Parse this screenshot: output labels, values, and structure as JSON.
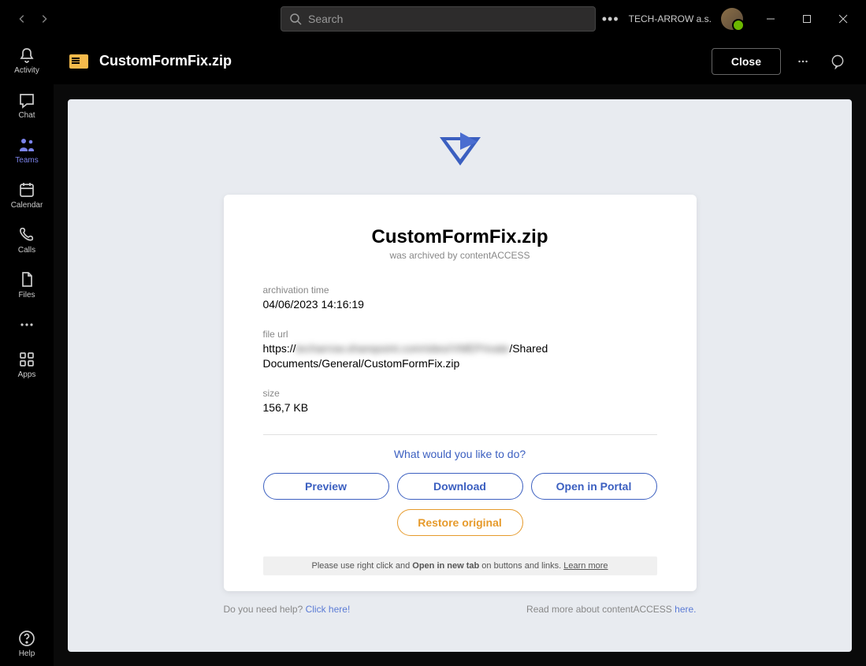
{
  "titlebar": {
    "search_placeholder": "Search",
    "org_name": "TECH-ARROW a.s."
  },
  "rail": {
    "items": [
      {
        "label": "Activity"
      },
      {
        "label": "Chat"
      },
      {
        "label": "Teams"
      },
      {
        "label": "Calendar"
      },
      {
        "label": "Calls"
      },
      {
        "label": "Files"
      }
    ],
    "apps_label": "Apps",
    "help_label": "Help"
  },
  "doc": {
    "title": "CustomFormFix.zip",
    "close_label": "Close"
  },
  "card": {
    "title": "CustomFormFix.zip",
    "subtitle": "was archived by contentACCESS",
    "meta": {
      "archivation_label": "archivation time",
      "archivation_value": "04/06/2023 14:16:19",
      "fileurl_label": "file url",
      "fileurl_prefix": "https://",
      "fileurl_blur": "techarrow.sharepoint.com/sites/VMEPrivate",
      "fileurl_suffix": "/Shared Documents/General/CustomFormFix.zip",
      "size_label": "size",
      "size_value": "156,7 KB"
    },
    "prompt": "What would you like to do?",
    "actions": {
      "preview": "Preview",
      "download": "Download",
      "open_portal": "Open in Portal",
      "restore": "Restore original"
    },
    "note_prefix": "Please use right click and ",
    "note_bold": "Open in new tab",
    "note_suffix": " on buttons and links. ",
    "note_link": "Learn more"
  },
  "footer": {
    "help_prefix": "Do you need help? ",
    "help_link": "Click here!",
    "read_prefix": "Read more about contentACCESS ",
    "read_link": "here."
  }
}
